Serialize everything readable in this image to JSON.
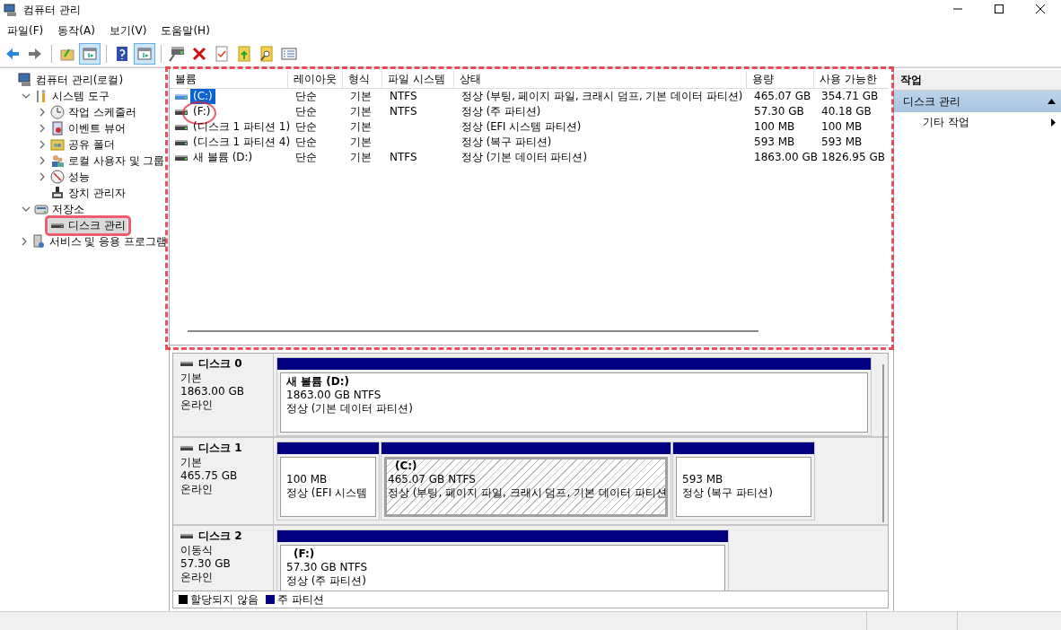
{
  "window": {
    "title": "컴퓨터 관리"
  },
  "menu": [
    "파일(F)",
    "동작(A)",
    "보기(V)",
    "도움말(H)"
  ],
  "toolbar": [
    {
      "kind": "back",
      "on": false
    },
    {
      "kind": "forward",
      "on": false
    },
    {
      "kind": "sep"
    },
    {
      "kind": "up",
      "on": false
    },
    {
      "kind": "tree",
      "on": true
    },
    {
      "kind": "sep"
    },
    {
      "kind": "help",
      "on": false
    },
    {
      "kind": "pane",
      "on": true
    },
    {
      "kind": "sep"
    },
    {
      "kind": "connect",
      "on": false
    },
    {
      "kind": "delete",
      "on": false
    },
    {
      "kind": "check",
      "on": false
    },
    {
      "kind": "export",
      "on": false
    },
    {
      "kind": "find",
      "on": false
    },
    {
      "kind": "list",
      "on": false
    }
  ],
  "tree": [
    {
      "label": "컴퓨터 관리(로컬)",
      "kind": "computer",
      "selected": false,
      "children": [
        {
          "label": "시스템 도구",
          "kind": "tools",
          "expanded": true,
          "selected": false,
          "children": [
            {
              "label": "작업 스케줄러",
              "kind": "clock",
              "expanded": false,
              "selected": false
            },
            {
              "label": "이벤트 뷰어",
              "kind": "event",
              "expanded": false,
              "selected": false
            },
            {
              "label": "공유 폴더",
              "kind": "share",
              "expanded": false,
              "selected": false
            },
            {
              "label": "로컬 사용자 및 그룹",
              "kind": "users",
              "expanded": false,
              "selected": false
            },
            {
              "label": "성능",
              "kind": "perf",
              "expanded": false,
              "selected": false
            },
            {
              "label": "장치 관리자",
              "kind": "device",
              "selected": false
            }
          ]
        },
        {
          "label": "저장소",
          "kind": "storage",
          "expanded": true,
          "selected": false,
          "children": [
            {
              "label": "디스크 관리",
              "kind": "disk",
              "selected": true,
              "annotated": true
            }
          ]
        },
        {
          "label": "서비스 및 응용 프로그램",
          "kind": "services",
          "expanded": false,
          "selected": false
        }
      ]
    }
  ],
  "table": {
    "annotated": true,
    "columns": [
      "볼륨",
      "레이아웃",
      "형식",
      "파일 시스템",
      "상태",
      "용량",
      "사용 가능한"
    ],
    "rows": [
      {
        "cells": [
          "(C:)",
          "단순",
          "기본",
          "NTFS",
          "정상 (부팅, 페이지 파일, 크래시 덤프, 기본 데이터 파티션)",
          "465.07 GB",
          "354.71 GB"
        ],
        "selected": true
      },
      {
        "cells": [
          "(F:)",
          "단순",
          "기본",
          "NTFS",
          "정상 (주 파티션)",
          "57.30 GB",
          "40.18 GB"
        ],
        "selected": false,
        "annotated": true
      },
      {
        "cells": [
          "(디스크 1 파티션 1)",
          "단순",
          "기본",
          "",
          "정상 (EFI 시스템 파티션)",
          "100 MB",
          "100 MB"
        ],
        "selected": false
      },
      {
        "cells": [
          "(디스크 1 파티션 4)",
          "단순",
          "기본",
          "",
          "정상 (복구 파티션)",
          "593 MB",
          "593 MB"
        ],
        "selected": false
      },
      {
        "cells": [
          "새 볼륨 (D:)",
          "단순",
          "기본",
          "NTFS",
          "정상 (기본 데이터 파티션)",
          "1863.00 GB",
          "1826.95 GB"
        ],
        "selected": false
      }
    ]
  },
  "disks": [
    {
      "name": "디스크 0",
      "type": "기본",
      "size": "1863.00 GB",
      "status": "온라인",
      "partitions": [
        {
          "label": "새 볼륨  (D:)",
          "size": "1863.00 GB NTFS",
          "status": "정상 (기본 데이터 파티션)",
          "selected": false
        }
      ]
    },
    {
      "name": "디스크 1",
      "type": "기본",
      "size": "465.75 GB",
      "status": "온라인",
      "partitions": [
        {
          "size": "100 MB",
          "status": "정상 (EFI 시스템",
          "selected": false
        },
        {
          "label": "(C:)",
          "size": "465.07 GB NTFS",
          "status": "정상 (부팅, 페이지 파일, 크래시 덤프, 기본 데이터 파티션",
          "selected": true
        },
        {
          "size": "593 MB",
          "status": "정상 (복구 파티션)",
          "selected": false
        }
      ]
    },
    {
      "name": "디스크 2",
      "type": "이동식",
      "size": "57.30 GB",
      "status": "온라인",
      "partitions": [
        {
          "label": "(F:)",
          "size": "57.30 GB NTFS",
          "status": "정상 (주 파티션)",
          "selected": false
        }
      ]
    }
  ],
  "legend": [
    {
      "label": "할당되지 않음",
      "color": "#000000"
    },
    {
      "label": "주 파티션",
      "color": "#000080"
    }
  ],
  "actions": {
    "title": "작업",
    "sections": [
      {
        "title": "디스크 관리",
        "expanded": true,
        "items": [
          {
            "label": "기타 작업"
          }
        ]
      }
    ]
  }
}
